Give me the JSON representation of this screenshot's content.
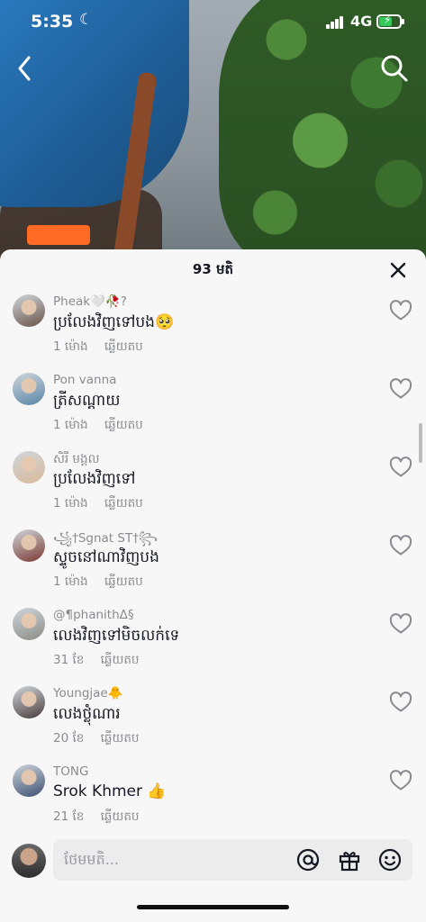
{
  "status_bar": {
    "time": "5:35",
    "moon_icon": "☾",
    "network": "4G",
    "battery_color": "#34c759"
  },
  "video": {
    "back_icon": "chevron-left-icon",
    "search_icon": "search-icon"
  },
  "comments_sheet": {
    "title": "93 មតិ",
    "close_icon": "close-icon",
    "reply_label": "ឆ្លើយតប",
    "comments": [
      {
        "username": "Pheak🤍🥀?",
        "text": "ប្រលែងវិញទៅបង🥺",
        "time": "1 ម៉ោង",
        "avatar_color": "#6b5448"
      },
      {
        "username": "Pon vanna",
        "text": "ត្រីសណ្តាយ",
        "time": "1 ម៉ោង",
        "avatar_color": "#5a86a6"
      },
      {
        "username": "សិរី មង្គល",
        "text": "ប្រលែងវិញទៅ",
        "time": "1 ម៉ោង",
        "avatar_color": "#d9b99a"
      },
      {
        "username": "꧁†Sgnat ST†꧂",
        "text": "ស្ទូចនៅណាវិញបង",
        "time": "1 ម៉ោង",
        "avatar_color": "#7a3a32"
      },
      {
        "username": "@¶phanithΔ§",
        "text": "លេងវិញទៅមិចលក់ទេ",
        "time": "31 ខែ",
        "avatar_color": "#8c8c86"
      },
      {
        "username": "Youngjae🐥",
        "text": "លេងថ្លុំណារ",
        "time": "20 ខែ",
        "avatar_color": "#4a3c3c"
      },
      {
        "username": "TONG",
        "text": "Srok Khmer 👍",
        "time": "21 ខែ",
        "avatar_color": "#3d4f72"
      }
    ],
    "composer": {
      "placeholder": "ថែមមតិ...",
      "at_icon": "at-icon",
      "gift_icon": "gift-icon",
      "emoji_icon": "emoji-icon"
    }
  }
}
